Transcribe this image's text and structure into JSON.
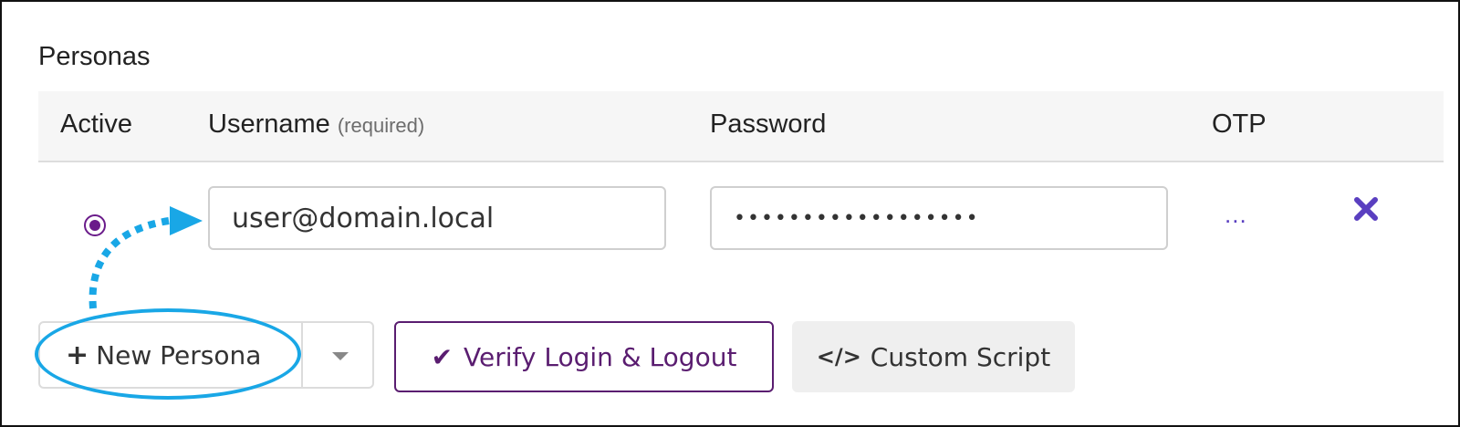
{
  "section": {
    "title": "Personas"
  },
  "table": {
    "headers": {
      "active": "Active",
      "username": "Username",
      "username_hint": "(required)",
      "password": "Password",
      "otp": "OTP"
    },
    "row": {
      "username": "user@domain.local",
      "password_mask": "••••••••••••••••••",
      "otp_more": "...",
      "delete_icon": "x-icon"
    }
  },
  "actions": {
    "new_persona": "New Persona",
    "verify": "Verify Login & Logout",
    "custom_script": "Custom Script"
  },
  "icons": {
    "plus": "+",
    "check": "✔",
    "code": "</>"
  },
  "colors": {
    "accent_purple": "#5a1d70",
    "delete_purple": "#5a3fc0",
    "annotation_blue": "#19a7e6"
  }
}
